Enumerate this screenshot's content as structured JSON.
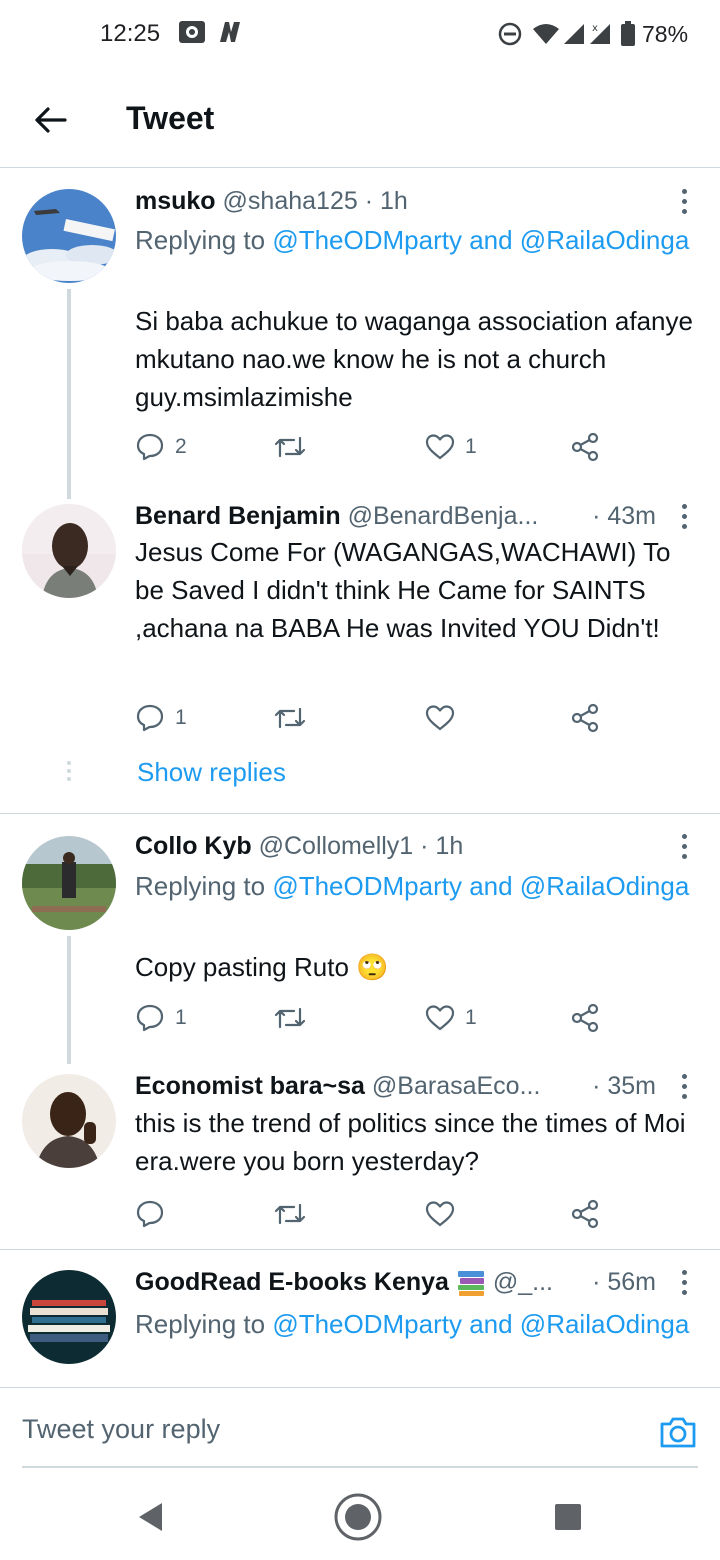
{
  "status_bar": {
    "time": "12:25",
    "battery": "78%"
  },
  "header": {
    "title": "Tweet"
  },
  "tweets": [
    {
      "name": "msuko",
      "handle": "@shaha125 · 1h",
      "replying_prefix": "Replying to ",
      "replying_to": "@TheODMparty and @RailaOdinga",
      "text": "Si baba achukue to waganga association afanye mkutano nao.we know he is not a church guy.msimlazimishe",
      "reply_count": "2",
      "like_count": "1"
    },
    {
      "name": "Benard Benjamin",
      "handle": "@BenardBenja...",
      "time": "· 43m",
      "text": "Jesus Come For (WAGANGAS,WACHAWI) To be Saved I didn't think He Came for SAINTS ,achana na BABA He was Invited YOU Didn't!",
      "reply_count": "1",
      "like_count": "",
      "show_replies": "Show replies"
    },
    {
      "name": "Collo Kyb",
      "handle": "@Collomelly1 · 1h",
      "replying_prefix": "Replying to ",
      "replying_to": "@TheODMparty and @RailaOdinga",
      "text": "Copy pasting Ruto 🙄",
      "reply_count": "1",
      "like_count": "1"
    },
    {
      "name": "Economist bara~sa",
      "handle": "@BarasaEco...",
      "time": "· 35m",
      "text": "this is the trend of politics since the times of Moi era.were you born yesterday?",
      "reply_count": "",
      "like_count": ""
    },
    {
      "name": "GoodRead E-books Kenya",
      "handle": "@_...",
      "time": "· 56m",
      "replying_prefix": "Replying to ",
      "replying_to": "@TheODMparty and @RailaOdinga"
    }
  ],
  "reply_bar": {
    "placeholder": "Tweet your reply"
  },
  "icons": {
    "back": "arrow-left-icon",
    "more": "more-vertical-icon",
    "reply": "comment-icon",
    "retweet": "retweet-icon",
    "like": "heart-icon",
    "share": "share-icon",
    "camera": "camera-icon",
    "nav_back": "triangle-back-icon",
    "nav_home": "circle-home-icon",
    "nav_recents": "square-recents-icon"
  },
  "colors": {
    "link": "#1d9bf0",
    "secondary_text": "#536471",
    "divider": "#cfd9de"
  }
}
